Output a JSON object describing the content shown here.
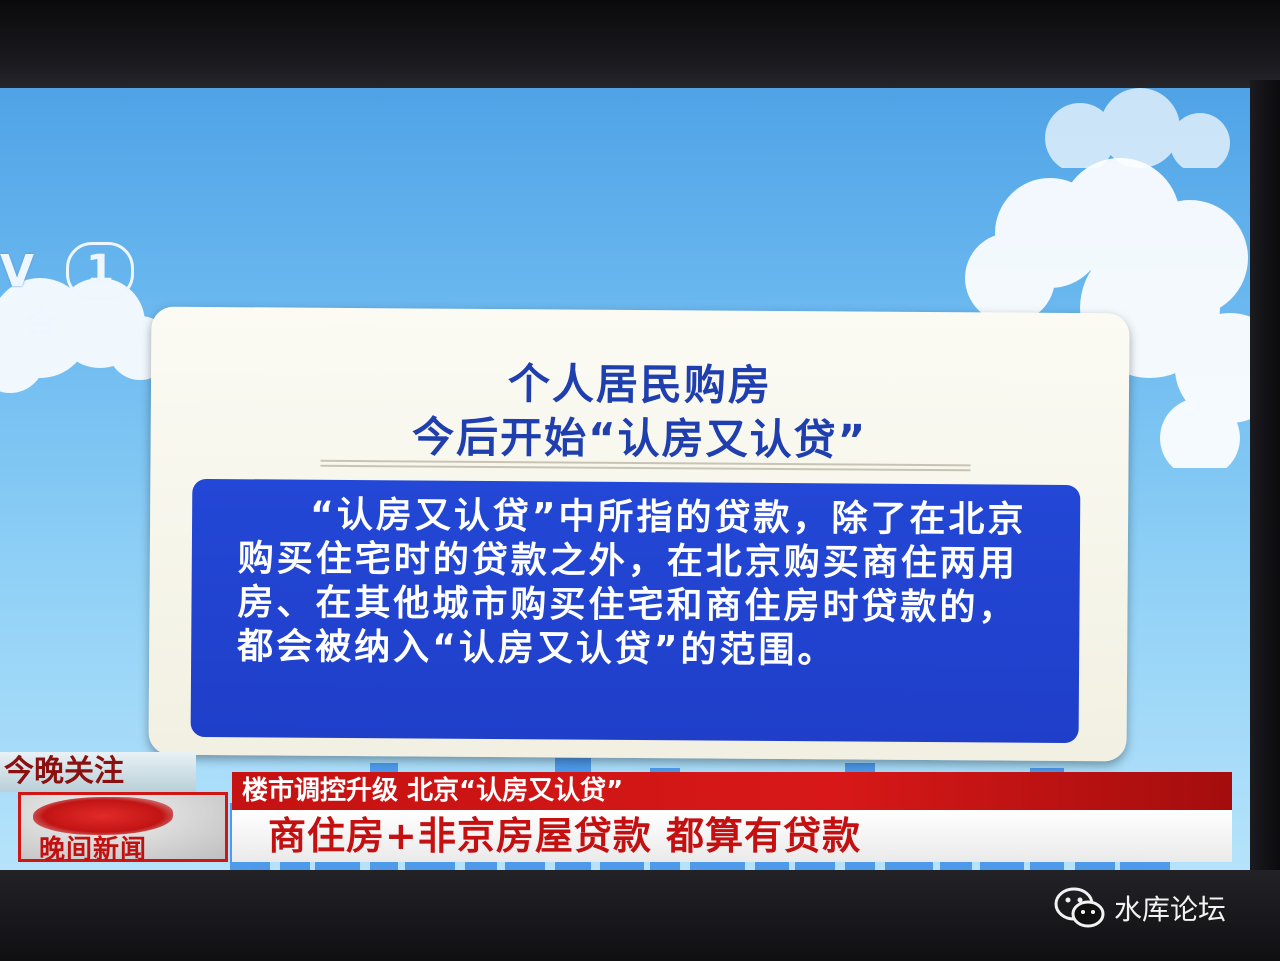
{
  "channel": {
    "logo_letters": "V",
    "logo_number": "1",
    "logo_sub": "合"
  },
  "card": {
    "title_line1": "个人居民购房",
    "title_line2": "今后开始“认房又认贷”",
    "body": "“认房又认贷”中所指的贷款，除了在北京购买住宅时的贷款之外，在北京购买商住两用房、在其他城市购买住宅和商住房时贷款的，都会被纳入“认房又认贷”的范围。"
  },
  "ticker": {
    "tag": "今晚关注",
    "program_name": "晚间新闻",
    "headline": "楼市调控升级 北京“认房又认贷”",
    "subheadline": "商住房+非京房屋贷款 都算有贷款"
  },
  "watermark": {
    "text": "水库论坛",
    "icon": "wechat-icon"
  },
  "colors": {
    "sky": "#6dbaf0",
    "title_blue": "#1f3fae",
    "body_blue": "#1f3fc9",
    "ticker_red": "#c51212"
  }
}
